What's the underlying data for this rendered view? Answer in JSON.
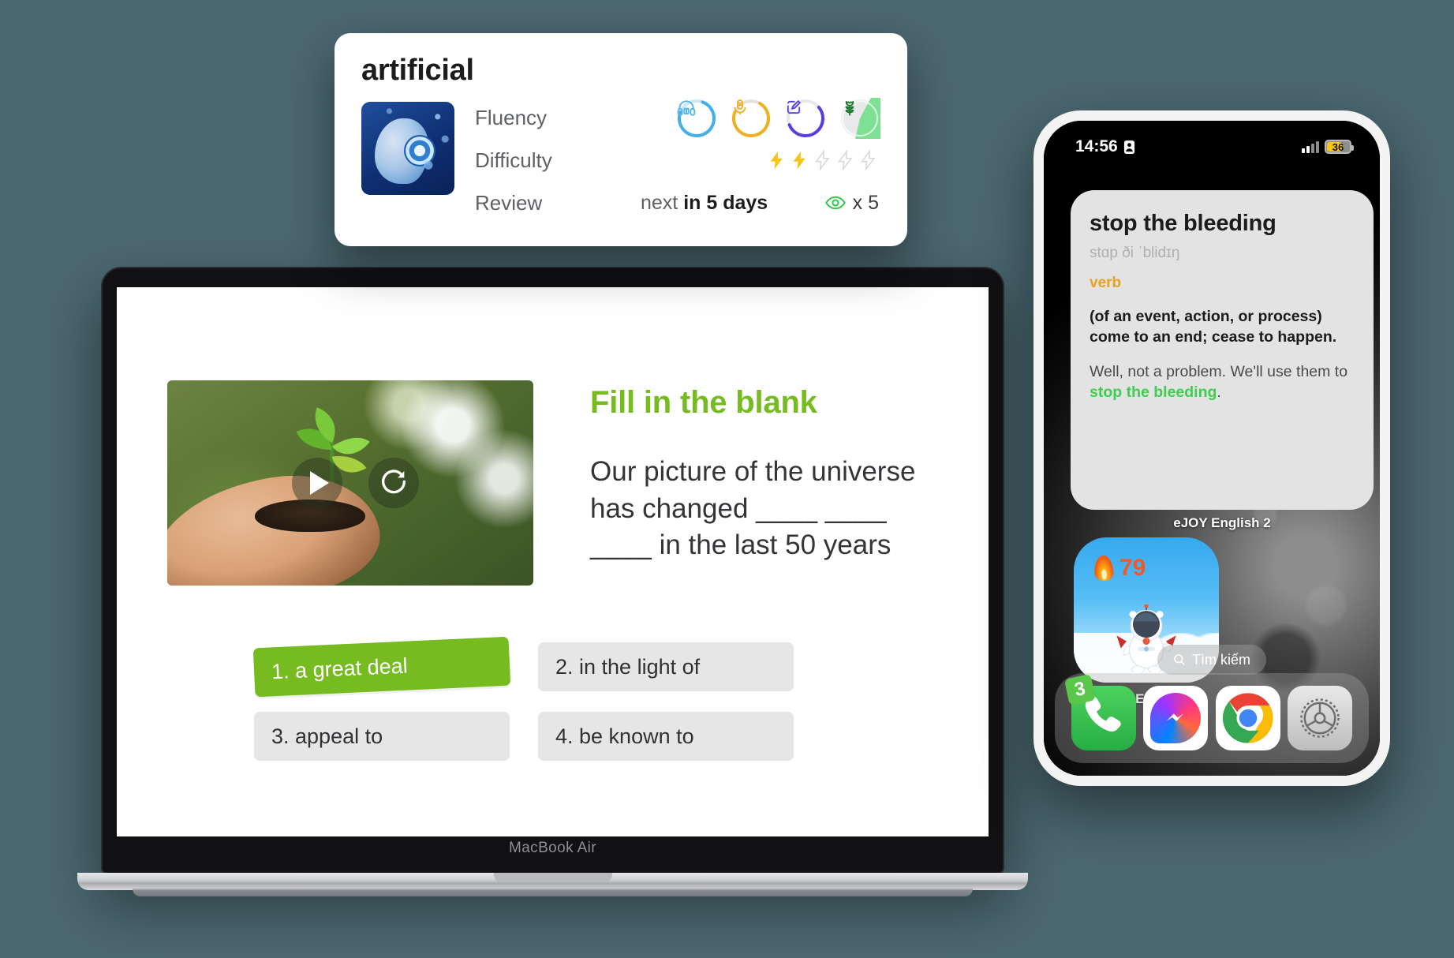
{
  "background_color": "#4b6770",
  "flashcard": {
    "word": "artificial",
    "thumbnail_icon": "ai-robot-head-image",
    "rows": [
      {
        "label": "Fluency",
        "mid": "",
        "right": ""
      },
      {
        "label": "Difficulty",
        "mid": "",
        "right": ""
      },
      {
        "label": "Review",
        "mid_prefix": "next",
        "mid_value": "in 5 days",
        "right": "x 5"
      }
    ],
    "labels": {
      "fluency": "Fluency",
      "difficulty": "Difficulty",
      "review": "Review"
    },
    "review": {
      "prefix": "next",
      "value": "in 5 days",
      "eye_count": "x 5",
      "eye_color": "#35c94b"
    },
    "difficulty": {
      "filled": 2,
      "total": 5,
      "filled_color": "#f5c518",
      "empty_color": "#d8d9db"
    },
    "skills": [
      {
        "name": "listening",
        "icon": "headphones-icon",
        "color": "#44b0e8",
        "progress": 75
      },
      {
        "name": "speaking",
        "icon": "microphone-icon",
        "color": "#efb01f",
        "progress": 72
      },
      {
        "name": "writing",
        "icon": "pencil-edit-icon",
        "color": "#5a3fe0",
        "progress": 55
      },
      {
        "name": "mastery",
        "icon": "plant-flower-icon",
        "color": "#5fd97a",
        "progress": 92
      }
    ]
  },
  "laptop": {
    "model_label": "MacBook Air",
    "lesson": {
      "video": {
        "alt": "hands holding a green seedling in soil",
        "play_icon": "play-icon",
        "replay_icon": "replay-icon"
      },
      "title": "Fill in the blank",
      "title_color": "#76bc21",
      "question": "Our picture of the universe has changed ____ ____ ____ in the last 50 years",
      "question_before": "Our picture of the universe has changed",
      "question_blanks": "____ ____ ____",
      "question_after": "in the last 50 years",
      "options": [
        {
          "label": "1. a great deal",
          "selected": true
        },
        {
          "label": "2. in the light of",
          "selected": false
        },
        {
          "label": "3. appeal to",
          "selected": false
        },
        {
          "label": "4. be known to",
          "selected": false
        }
      ],
      "selected_color": "#76bc21"
    }
  },
  "phone": {
    "status_bar": {
      "time": "14:56",
      "left_icon": "lock-portrait-orientation-icon",
      "signal_icon": "cellular-signal-icon",
      "battery_level": "36",
      "battery_icon": "battery-low-power-icon"
    },
    "widget": {
      "word": "stop the bleeding",
      "ipa": "stɑp ði ˈblidɪŋ",
      "part_of_speech": "verb",
      "pos_color": "#e8a220",
      "definition": "(of an event, action, or process) come to an end; cease to happen.",
      "example_before": "Well, not a problem. We'll use them to ",
      "example_highlight": "stop the bleeding",
      "example_after": ".",
      "highlight_color": "#3ece4f",
      "caption": "eJOY English 2"
    },
    "app": {
      "label": "eJOY English 2",
      "streak_count": "79",
      "streak_icon": "flame-icon",
      "mascot_icon": "astronaut-bear-mascot-icon"
    },
    "search": {
      "label": "Tìm kiếm",
      "icon": "search-icon"
    },
    "dock": [
      {
        "name": "phone",
        "label": "Phone",
        "badge": "3",
        "icon": "phone-handset-icon"
      },
      {
        "name": "messenger",
        "label": "Messenger",
        "badge": "",
        "icon": "messenger-bolt-icon"
      },
      {
        "name": "chrome",
        "label": "Chrome",
        "badge": "",
        "icon": "chrome-icon"
      },
      {
        "name": "settings",
        "label": "Settings",
        "badge": "",
        "icon": "gear-icon"
      }
    ]
  }
}
